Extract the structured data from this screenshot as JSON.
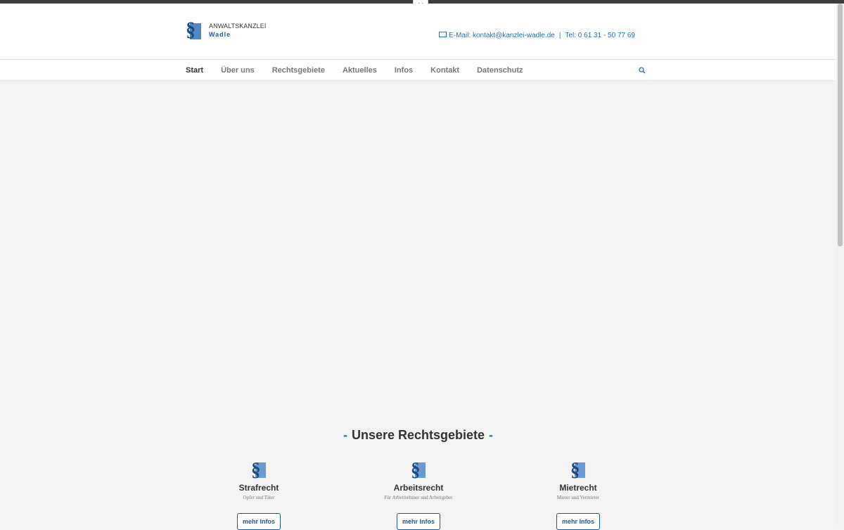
{
  "header": {
    "logo_line1": "ANWALTSKANZLEI",
    "logo_line2": "Wadle",
    "email_text": "E-Mail: kontakt@kanzlei-wadle.de",
    "separator": "|",
    "phone_text": "Tel: 0 61 31 - 50 77 69"
  },
  "nav": {
    "items": [
      {
        "label": "Start"
      },
      {
        "label": "Über uns"
      },
      {
        "label": "Rechtsgebiete"
      },
      {
        "label": "Aktuelles"
      },
      {
        "label": "Infos"
      },
      {
        "label": "Kontakt"
      },
      {
        "label": "Datenschutz"
      }
    ]
  },
  "section": {
    "title": "Unsere Rechtsgebiete",
    "dash": "-",
    "cards": [
      {
        "title": "Strafrecht",
        "subtitle": "Opfer und Täter",
        "button": "mehr Infos"
      },
      {
        "title": "Arbeitsrecht",
        "subtitle": "Für Arbeitnehmer und Arbeitgeber",
        "button": "mehr Infos"
      },
      {
        "title": "Mietrecht",
        "subtitle": "Mieter und Vermieter",
        "button": "mehr Infos"
      }
    ]
  },
  "colors": {
    "accent": "#1e73be",
    "topbar": "#3c3c3c",
    "background": "#f3f3f3"
  },
  "icons": {
    "logo": "paragraph-icon",
    "toggle": "chevron-down-icon",
    "mail": "envelope-icon",
    "search": "search-icon"
  }
}
